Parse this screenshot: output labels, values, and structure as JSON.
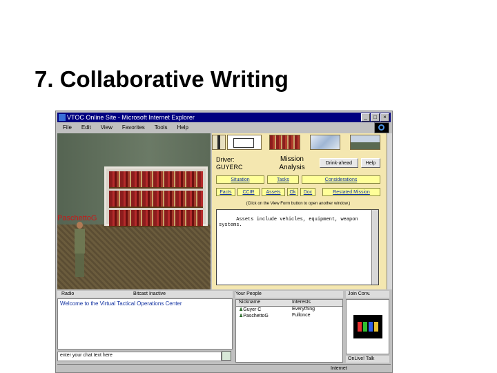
{
  "slide": {
    "title": "7. Collaborative Writing"
  },
  "window": {
    "title": "VTOC Online Site - Microsoft Internet Explorer",
    "controls": [
      "_",
      "□",
      "×"
    ],
    "menu": [
      "File",
      "Edit",
      "View",
      "Favorites",
      "Tools",
      "Help"
    ]
  },
  "scene": {
    "avatar_label": "PaschettoG"
  },
  "panel": {
    "driver_label": "Driver:",
    "driver_name": "GUYERC",
    "mission": "Mission Analysis",
    "buttons": {
      "disk": "Drink-ahead",
      "help": "Help"
    },
    "nav_row1": [
      "Situation",
      "Tasks",
      "Considerations"
    ],
    "nav_row2": [
      "Facts",
      "CCIR",
      "Assets",
      "Ok",
      "Doc",
      "Restated Mission"
    ],
    "hint": "(Click on the View Form button to open another window.)",
    "editor_text": "Assets include vehicles, equipment, weapon systems."
  },
  "bottom": {
    "radio_tab": "Radio",
    "radio_tab2": "Bitcast Inactive",
    "chat_message": "Welcome to the Virtual Tactical Operations Center",
    "chat_placeholder": "enter your chat text here",
    "people_tab": "Your People",
    "people_columns": [
      "Nickname",
      "Interests"
    ],
    "people": [
      {
        "nick": "Guyer C",
        "interest": "Everything"
      },
      {
        "nick": "PaschettoG",
        "interest": "Fullonce"
      }
    ],
    "onlive_tab": "Join Conv.",
    "onlive_footer": "OnLive! Talk"
  },
  "status": {
    "zone": "Internet"
  }
}
